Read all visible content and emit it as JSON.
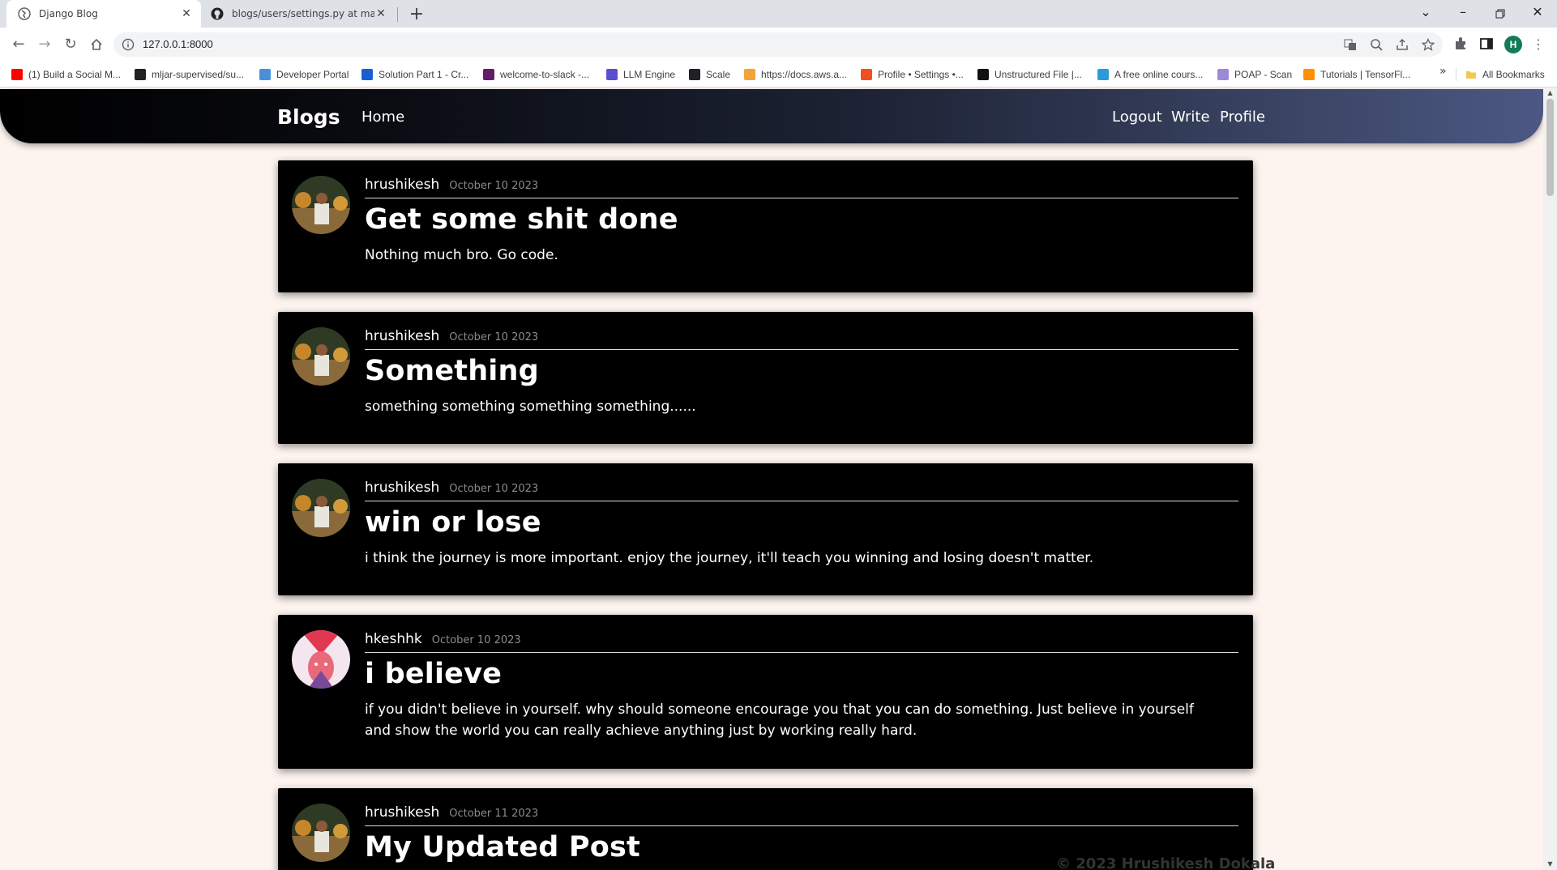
{
  "browser": {
    "tabs": [
      {
        "title": "Django Blog",
        "active": true
      },
      {
        "title": "blogs/users/settings.py at main",
        "active": false
      }
    ],
    "url": "127.0.0.1:8000",
    "profile_initial": "H",
    "bookmarks": [
      {
        "label": "(1) Build a Social M...",
        "icon": "youtube-icon",
        "color": "#ff0000"
      },
      {
        "label": "mljar-supervised/su...",
        "icon": "github-icon",
        "color": "#202124"
      },
      {
        "label": "Developer Portal",
        "icon": "portal-icon",
        "color": "#4a90d9"
      },
      {
        "label": "Solution Part 1 - Cr...",
        "icon": "c-icon",
        "color": "#1a5fd1"
      },
      {
        "label": "welcome-to-slack -...",
        "icon": "slack-icon",
        "color": "#611f69"
      },
      {
        "label": "LLM Engine",
        "icon": "llm-icon",
        "color": "#5a4fcf"
      },
      {
        "label": "Scale",
        "icon": "github-icon",
        "color": "#202124"
      },
      {
        "label": "https://docs.aws.a...",
        "icon": "aws-icon",
        "color": "#f2a33a"
      },
      {
        "label": "Profile • Settings •...",
        "icon": "microsoft-icon",
        "color": "#f25022"
      },
      {
        "label": "Unstructured File |...",
        "icon": "unstructured-icon",
        "color": "#111111"
      },
      {
        "label": "A free online cours...",
        "icon": "course-icon",
        "color": "#2b9bd8"
      },
      {
        "label": "POAP - Scan",
        "icon": "poap-icon",
        "color": "#9b8bd6"
      },
      {
        "label": "Tutorials | TensorFl...",
        "icon": "tensorflow-icon",
        "color": "#ff8f00"
      }
    ],
    "bookmarks_more": "»",
    "all_bookmarks": "All Bookmarks"
  },
  "navbar": {
    "brand": "Blogs",
    "home": "Home",
    "logout": "Logout",
    "write": "Write",
    "profile": "Profile"
  },
  "posts": [
    {
      "author": "hrushikesh",
      "date": "October 10 2023",
      "title": "Get some shit done",
      "body": "Nothing much bro. Go code.",
      "avatar": "person-photo"
    },
    {
      "author": "hrushikesh",
      "date": "October 10 2023",
      "title": "Something",
      "body": "something something something something......",
      "avatar": "person-photo"
    },
    {
      "author": "hrushikesh",
      "date": "October 10 2023",
      "title": "win or lose",
      "body": "i think the journey is more important. enjoy the journey, it'll teach you winning and losing doesn't matter.",
      "avatar": "person-photo"
    },
    {
      "author": "hkeshhk",
      "date": "October 10 2023",
      "title": "i believe",
      "body": "if you didn't believe in yourself. why should someone encourage you that you can do something. Just believe in yourself and show the world you can really achieve anything just by working really hard.",
      "avatar": "anime-photo"
    },
    {
      "author": "hrushikesh",
      "date": "October 11 2023",
      "title": "My Updated Post",
      "body": "",
      "avatar": "person-photo"
    }
  ],
  "footer": "© 2023 Hrushikesh Dokala"
}
